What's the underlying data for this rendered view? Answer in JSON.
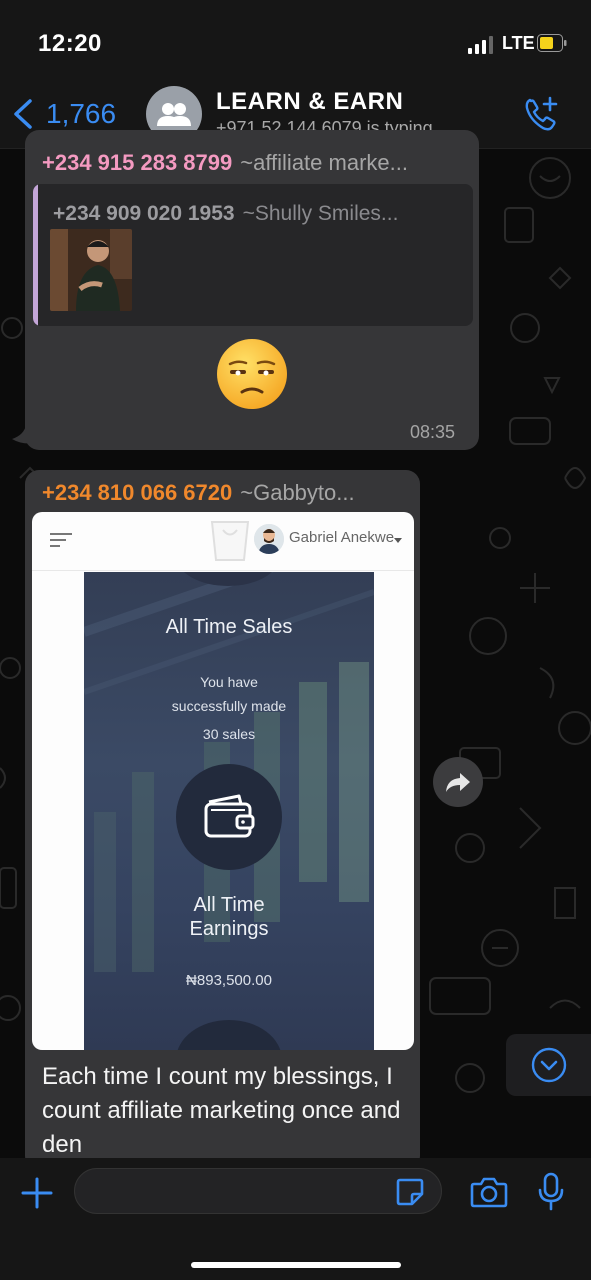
{
  "status_bar": {
    "time": "12:20",
    "network": "LTE"
  },
  "nav": {
    "back_count": "1,766",
    "title": "LEARN & EARN",
    "subtitle": "+971 52 144 6079 is typing..."
  },
  "messages": [
    {
      "sender_number": "+234 915 283 8799",
      "sender_name": "~affiliate marke...",
      "quoted": {
        "sender_number": "+234 909 020 1953",
        "sender_name": "~Shully Smiles..."
      },
      "emoji": "unamused-face",
      "time": "08:35"
    },
    {
      "sender_number": "+234 810 066 6720",
      "sender_name": "~Gabbyto...",
      "image": {
        "user_name": "Gabriel Anekwe",
        "sales_title": "All Time Sales",
        "sales_line1": "You have",
        "sales_line2": "successfully made",
        "sales_line3": "30 sales",
        "earnings_title_line1": "All Time",
        "earnings_title_line2": "Earnings",
        "earnings_amount": "₦893,500.00"
      },
      "caption": "Each time I count my blessings, I count affiliate marketing once and den"
    }
  ],
  "composer": {
    "placeholder": ""
  },
  "colors": {
    "accent": "#3a8cf2",
    "sender1": "#f49ac1",
    "sender2": "#f0882c",
    "bubble": "#363638"
  }
}
